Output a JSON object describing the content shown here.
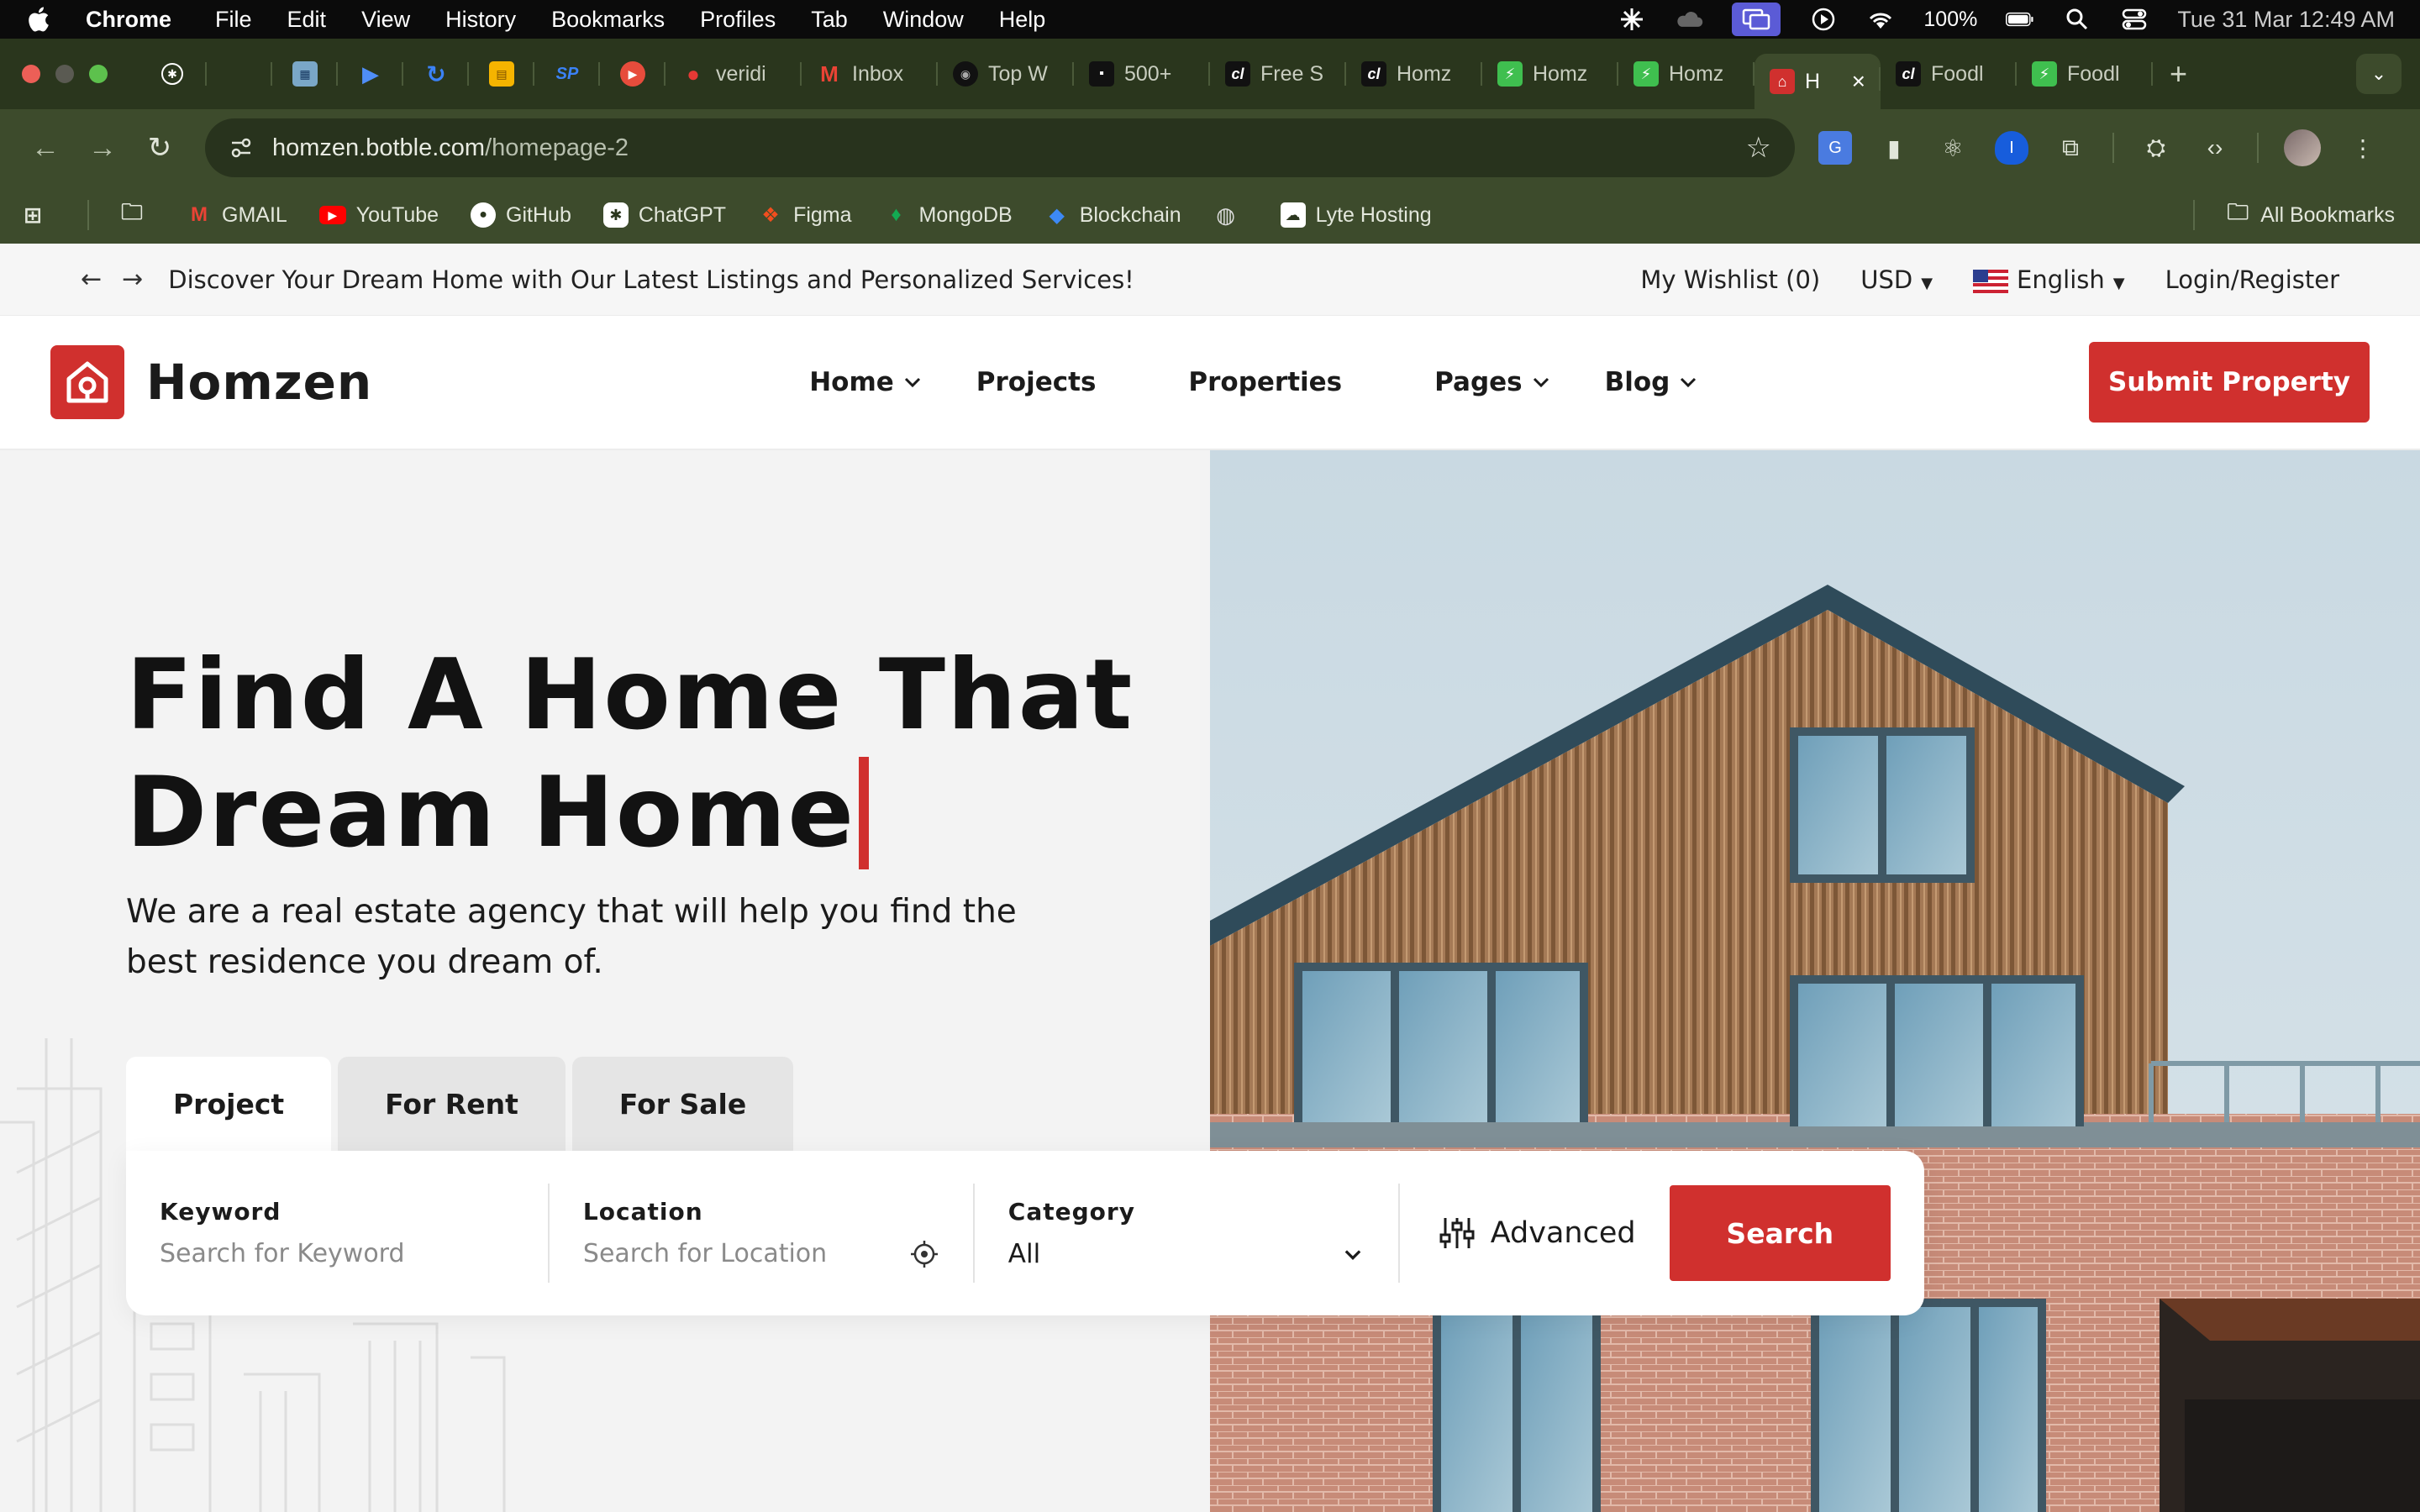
{
  "menubar": {
    "app": "Chrome",
    "items": [
      "File",
      "Edit",
      "View",
      "History",
      "Bookmarks",
      "Profiles",
      "Tab",
      "Window",
      "Help"
    ],
    "battery": "100%",
    "clock": "Tue 31 Mar  12:49 AM"
  },
  "tabs": {
    "pinned": [
      {
        "icon": "openai-icon",
        "color": "#ffffff"
      },
      {
        "icon": "blank-icon",
        "color": "#2a361d"
      },
      {
        "icon": "qr-icon",
        "color": "#7aa7c7"
      },
      {
        "icon": "play-icon",
        "color": "#3b82f6"
      },
      {
        "icon": "sync-icon",
        "color": "#3b82f6"
      },
      {
        "icon": "sheets-icon",
        "color": "#f5b400"
      },
      {
        "icon": "sp-icon",
        "color": "#3b82f6"
      },
      {
        "icon": "record-icon",
        "color": "#e74c3c"
      }
    ],
    "items": [
      {
        "label": "veridi",
        "fav": "•",
        "color": "#e53935"
      },
      {
        "label": "Inbox",
        "fav": "M",
        "color": "#ea4335"
      },
      {
        "label": "Top W",
        "fav": "•",
        "color": "#111111"
      },
      {
        "label": "500+",
        "fav": "▪",
        "color": "#111111"
      },
      {
        "label": "Free S",
        "fav": "cl",
        "color": "#111111"
      },
      {
        "label": "Homz",
        "fav": "cl",
        "color": "#111111"
      },
      {
        "label": "Homz",
        "fav": "⚡",
        "color": "#3fbf4f"
      },
      {
        "label": "Homz",
        "fav": "⚡",
        "color": "#3fbf4f"
      }
    ],
    "active": {
      "label": "H",
      "fav": "⌂",
      "color": "#d0302e"
    },
    "after": [
      {
        "label": "Foodl",
        "fav": "cl",
        "color": "#111111"
      },
      {
        "label": "Foodl",
        "fav": "⚡",
        "color": "#3fbf4f"
      }
    ],
    "new_tab": "+"
  },
  "toolbar": {
    "url_host": "homzen.botble.com",
    "url_path": "/homepage-2"
  },
  "bookmarks": {
    "items": [
      {
        "label": "GMAIL",
        "icon": "gmail-icon",
        "fav": "M",
        "color": "#ea4335"
      },
      {
        "label": "YouTube",
        "icon": "youtube-icon",
        "fav": "▶",
        "color": "#ff0000"
      },
      {
        "label": "GitHub",
        "icon": "github-icon",
        "fav": "●",
        "color": "#ffffff"
      },
      {
        "label": "ChatGPT",
        "icon": "openai-icon",
        "fav": "✱",
        "color": "#ffffff"
      },
      {
        "label": "Figma",
        "icon": "figma-icon",
        "fav": "F",
        "color": "#f24e1e"
      },
      {
        "label": "MongoDB",
        "icon": "mongodb-icon",
        "fav": "♦",
        "color": "#13aa52"
      },
      {
        "label": "Blockchain",
        "icon": "blockchain-icon",
        "fav": "◆",
        "color": "#3d89f5"
      },
      {
        "label": "",
        "icon": "globe-icon",
        "fav": "◍",
        "color": "#cccccc"
      },
      {
        "label": "Lyte Hosting",
        "icon": "lyte-icon",
        "fav": "☁",
        "color": "#ffffff"
      }
    ],
    "all": "All Bookmarks"
  },
  "site": {
    "announcement": "Discover Your Dream Home with Our Latest Listings and Personalized Services!",
    "wishlist": "My Wishlist (0)",
    "currency": "USD",
    "language": "English",
    "login": "Login/Register",
    "brand": "Homzen",
    "brand_color": "#d0302e",
    "nav": [
      {
        "label": "Home",
        "dropdown": true
      },
      {
        "label": "Projects",
        "dropdown": false
      },
      {
        "label": "Properties",
        "dropdown": false
      },
      {
        "label": "Pages",
        "dropdown": true
      },
      {
        "label": "Blog",
        "dropdown": true
      }
    ],
    "submit": "Submit Property"
  },
  "hero": {
    "title_line1": "Find A Home That",
    "title_line2": "Dream Home",
    "subtitle": "We are a real estate agency that will help you find the best residence you dream of.",
    "tabs": [
      "Project",
      "For Rent",
      "For Sale"
    ],
    "active_tab": "Project",
    "search": {
      "keyword_label": "Keyword",
      "keyword_placeholder": "Search for Keyword",
      "location_label": "Location",
      "location_placeholder": "Search for Location",
      "category_label": "Category",
      "category_value": "All",
      "advanced": "Advanced",
      "button": "Search"
    }
  }
}
